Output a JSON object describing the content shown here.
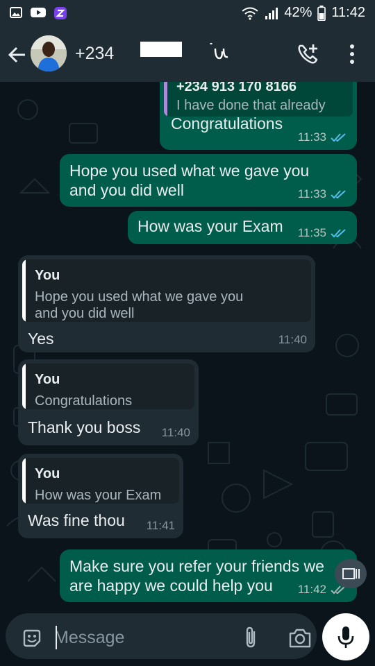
{
  "status_bar": {
    "battery": "42%",
    "time": "11:42"
  },
  "header": {
    "contact_name": "+234"
  },
  "messages": [
    {
      "dir": "out",
      "quote": {
        "author": "+234 913 170 8166",
        "text": "I have done that already"
      },
      "text": "Congratulations",
      "time": "11:33"
    },
    {
      "dir": "out",
      "lines": [
        "Hope you used what we gave you",
        "and you did well"
      ],
      "time": "11:33"
    },
    {
      "dir": "out",
      "text": "How was your Exam",
      "time": "11:35"
    },
    {
      "dir": "in",
      "quote": {
        "author": "You",
        "lines": [
          "Hope you used what we gave you",
          "and you did well"
        ]
      },
      "text": "Yes",
      "time": "11:40"
    },
    {
      "dir": "in",
      "quote": {
        "author": "You",
        "text": "Congratulations"
      },
      "text": "Thank you boss",
      "time": "11:40"
    },
    {
      "dir": "in",
      "quote": {
        "author": "You",
        "text": "How was your Exam"
      },
      "text": "Was fine thou",
      "time": "11:41"
    },
    {
      "dir": "out",
      "lines": [
        "Make sure you refer your friends we",
        "are happy we could help you"
      ],
      "time": "11:42"
    }
  ],
  "input": {
    "placeholder": "Message"
  },
  "colors": {
    "outgoing_bubble": "#005c4b",
    "incoming_bubble": "#202c33",
    "read_ticks": "#53bdeb",
    "quote_bar_outgoing": "#a98bd8",
    "quote_bar_incoming": "#ffffff"
  },
  "icons": [
    "gallery-icon",
    "youtube-icon",
    "app-icon",
    "wifi-icon",
    "signal-icon",
    "battery-icon",
    "back-arrow-icon",
    "add-call-icon",
    "more-vert-icon",
    "emoji-icon",
    "attach-icon",
    "camera-icon",
    "mic-icon",
    "pip-icon"
  ]
}
